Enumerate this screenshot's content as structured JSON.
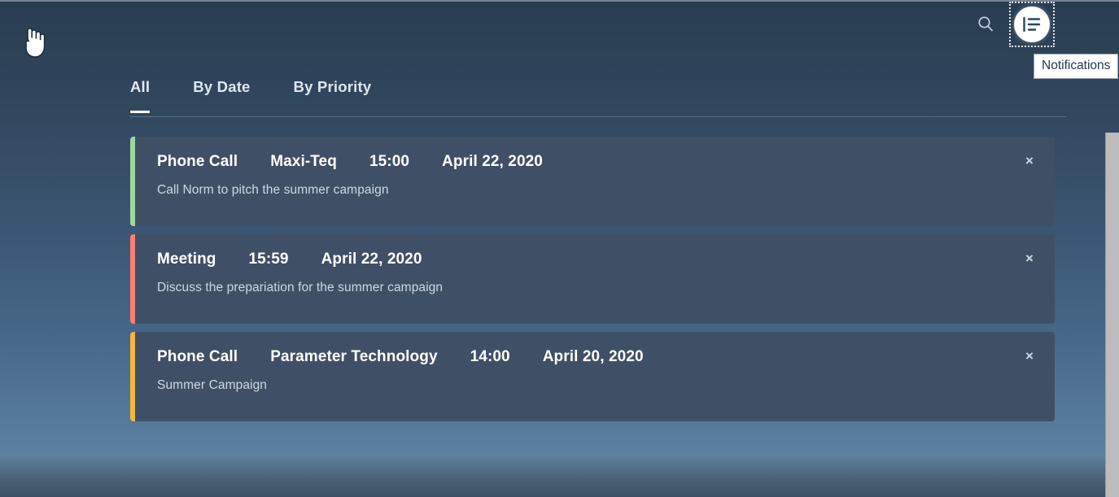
{
  "header": {
    "search_icon": "search-icon",
    "notifications_icon": "notifications-list-icon",
    "tooltip_text": "Notifications"
  },
  "tabs": [
    {
      "label": "All",
      "active": true
    },
    {
      "label": "By Date",
      "active": false
    },
    {
      "label": "By Priority",
      "active": false
    }
  ],
  "notifications": [
    {
      "accent_color": "#9fd6a0",
      "type": "Phone Call",
      "account": "Maxi-Teq",
      "time": "15:00",
      "date": "April 22, 2020",
      "description": "Call Norm to pitch the summer campaign",
      "close_label": "×"
    },
    {
      "accent_color": "#fa7e74",
      "type": "Meeting",
      "account": "",
      "time": "15:59",
      "date": "April 22, 2020",
      "description": "Discuss the prepariation for the summer campaign",
      "close_label": "×"
    },
    {
      "accent_color": "#f5b63f",
      "type": "Phone Call",
      "account": "Parameter Technology",
      "time": "14:00",
      "date": "April 20, 2020",
      "description": "Summer Campaign",
      "close_label": "×"
    }
  ],
  "colors": {
    "background_top": "#2a3d52",
    "background_mid": "#567b9a",
    "background_bottom": "#3d4f63",
    "card_background": "#3f5066",
    "accent_green": "#9fd6a0",
    "accent_red": "#fa7e74",
    "accent_orange": "#f5b63f",
    "tooltip_background": "#ffffff",
    "tooltip_text_color": "#24384d"
  }
}
